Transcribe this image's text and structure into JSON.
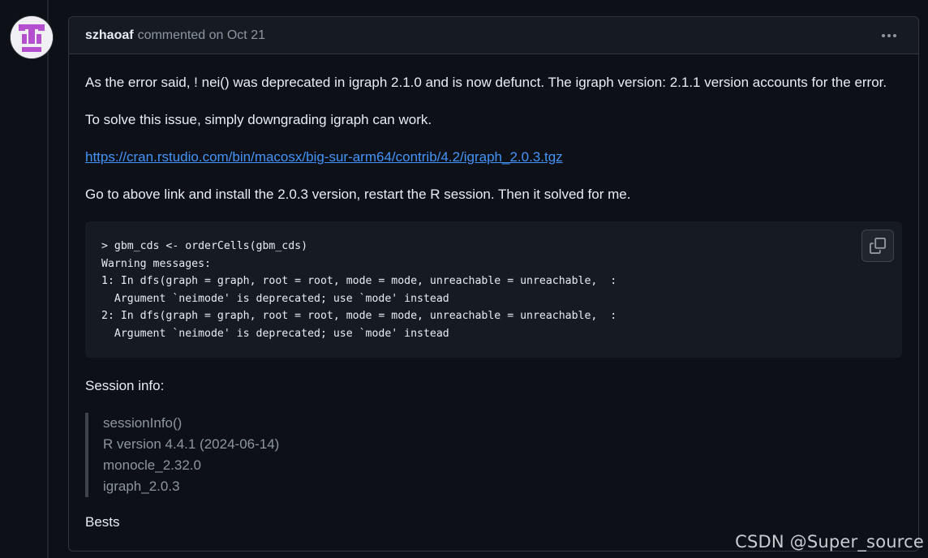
{
  "comment": {
    "author": "szhaoaf",
    "meta": "commented on Oct 21",
    "menu_icon": "kebab-horizontal-icon",
    "avatar_icon": "identicon-avatar",
    "paragraphs": {
      "p1": "As the error said, ! nei() was deprecated in igraph 2.1.0 and is now defunct. The igraph version: 2.1.1 version accounts for the error.",
      "p2": "To solve this issue, simply downgrading igraph can work.",
      "link": "https://cran.rstudio.com/bin/macosx/big-sur-arm64/contrib/4.2/igraph_2.0.3.tgz",
      "p3": "Go to above link and install the 2.0.3 version, restart the R session. Then it solved for me.",
      "session_label": "Session info:",
      "closing": "Bests"
    },
    "code": {
      "lines": [
        "> gbm_cds <- orderCells(gbm_cds)",
        "Warning messages:",
        "1: In dfs(graph = graph, root = root, mode = mode, unreachable = unreachable,  :",
        "  Argument `neimode' is deprecated; use `mode' instead",
        "2: In dfs(graph = graph, root = root, mode = mode, unreachable = unreachable,  :",
        "  Argument `neimode' is deprecated; use `mode' instead"
      ],
      "copy_icon": "copy-icon"
    },
    "session_info": [
      "sessionInfo()",
      "R version 4.4.1 (2024-06-14)",
      "monocle_2.32.0",
      "igraph_2.0.3"
    ]
  },
  "watermark": "CSDN @Super_source",
  "colors": {
    "background": "#0d1117",
    "header": "#161b22",
    "border": "#30363d",
    "link": "#4493f8",
    "muted": "#8d96a0",
    "avatar_purple": "#b44fd0"
  }
}
